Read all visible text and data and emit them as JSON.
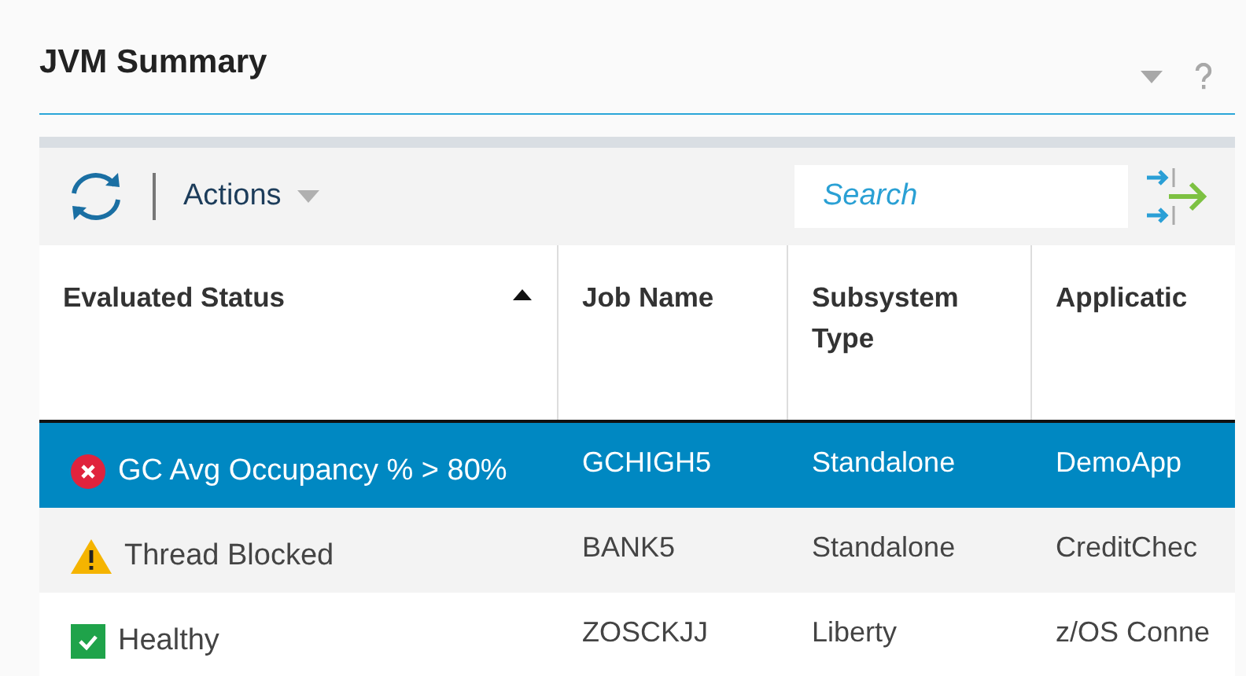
{
  "panel": {
    "title": "JVM Summary"
  },
  "toolbar": {
    "actions_label": "Actions",
    "search": {
      "placeholder": "Search"
    }
  },
  "table": {
    "columns": [
      {
        "label": "Evaluated Status",
        "sorted": true
      },
      {
        "label": "Job Name",
        "sorted": false
      },
      {
        "label": "Subsystem Type",
        "sorted": false
      },
      {
        "label": "Applicatic",
        "sorted": false
      }
    ],
    "rows": [
      {
        "kind": "error",
        "status": "GC Avg Occupancy % > 80%",
        "job_name": "GCHIGH5",
        "subsystem_type": "Standalone",
        "column_4": "DemoApp",
        "selected": true
      },
      {
        "kind": "warning",
        "status": "Thread Blocked",
        "job_name": "BANK5",
        "subsystem_type": "Standalone",
        "column_4": "CreditChec",
        "selected": false
      },
      {
        "kind": "healthy",
        "status": "Healthy",
        "job_name": "ZOSCKJJ",
        "subsystem_type": "Liberty",
        "column_4": "z/OS Conne",
        "selected": false
      }
    ]
  }
}
